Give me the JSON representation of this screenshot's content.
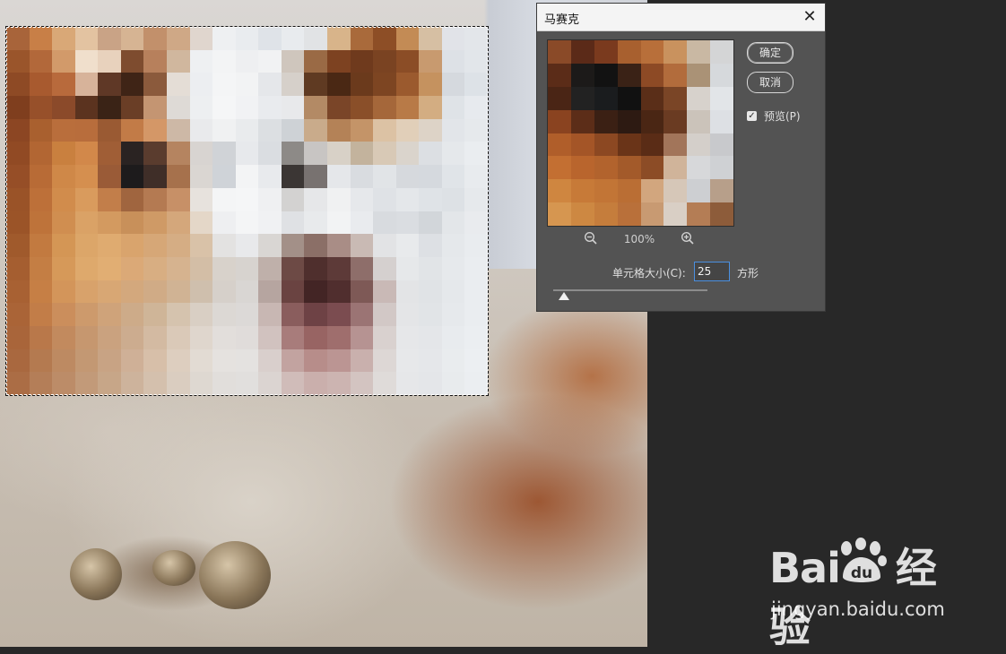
{
  "dialog": {
    "title": "马赛克",
    "close_symbol": "✕",
    "ok_label": "确定",
    "cancel_label": "取消",
    "preview_label": "预览(P)",
    "preview_checked": true,
    "zoom_out_icon": "zoom-out-icon",
    "zoom_in_icon": "zoom-in-icon",
    "zoom_level": "100%",
    "cell_size_label": "单元格大小(C):",
    "cell_size_value": "25",
    "cell_size_unit": "方形",
    "slider_fraction": 0.07
  },
  "watermark": {
    "logo_text": "Bai du 经验",
    "url": "jingyan.baidu.com"
  },
  "colors": {
    "dialog_bg": "#535353",
    "canvas_bg": "#282828",
    "input_focus": "#4a8fe0"
  },
  "mosaic_rows": [
    [
      "#a8643a",
      "#c87f47",
      "#d9a877",
      "#e3c3a1",
      "#c9a386",
      "#d6b493",
      "#c2906b",
      "#cfa886",
      "#e0d6ce",
      "#eef0f2",
      "#e9ecef",
      "#dfe3e8",
      "#e8ebee",
      "#e1e3e5",
      "#d8b48a",
      "#a96a3b",
      "#8d4e26",
      "#c38b55",
      "#d6bfa3",
      "#e1e3e8",
      "#e3e6ea"
    ],
    [
      "#9a552b",
      "#b2683a",
      "#d29a6a",
      "#f0dfcc",
      "#e8d2bd",
      "#7e4c2f",
      "#b7805c",
      "#d0b79e",
      "#eef0f2",
      "#f3f4f5",
      "#eeeff1",
      "#f1f2f3",
      "#cfc6bd",
      "#9a6a45",
      "#7d4221",
      "#6f3a1d",
      "#7a4322",
      "#8b4d26",
      "#c89a6f",
      "#dde1e6",
      "#e2e6ea"
    ],
    [
      "#8e4a25",
      "#a85a2f",
      "#b86a3c",
      "#d7b39a",
      "#5f3826",
      "#3f2416",
      "#8b5a3c",
      "#e4ddd6",
      "#eceef1",
      "#f4f5f6",
      "#f2f3f4",
      "#e5e7ea",
      "#d6d0ca",
      "#5f3a22",
      "#4a2814",
      "#6b3a1c",
      "#7d4522",
      "#9b5a2e",
      "#c5925f",
      "#d5d9de",
      "#dde2e7"
    ],
    [
      "#7f3e1e",
      "#97502a",
      "#8b4a2a",
      "#5b331f",
      "#3a2316",
      "#6a3e26",
      "#c49572",
      "#dedad6",
      "#edeff1",
      "#f5f6f7",
      "#f1f2f4",
      "#e9ebee",
      "#e8e9eb",
      "#b38a65",
      "#7a4528",
      "#8a4f29",
      "#a5673a",
      "#b87a47",
      "#d3ad82",
      "#dfe3e7",
      "#e7eaee"
    ],
    [
      "#8c4623",
      "#a9602f",
      "#b96e3c",
      "#b86d3c",
      "#9a5a33",
      "#c27b47",
      "#d49767",
      "#cdb8a6",
      "#e9eaec",
      "#f0f1f2",
      "#e9ebed",
      "#dcdfe2",
      "#ced2d6",
      "#c9ab8b",
      "#b48257",
      "#c49468",
      "#dcc2a4",
      "#e1cfb9",
      "#ddd3c7",
      "#e2e5e9",
      "#e6e9ec"
    ],
    [
      "#914a24",
      "#b26633",
      "#c9803f",
      "#d2884a",
      "#a05e36",
      "#2a2322",
      "#5a3c2e",
      "#b58460",
      "#d8d4d1",
      "#d0d3d7",
      "#e7e9ec",
      "#dadde1",
      "#8d8a87",
      "#c8c5c3",
      "#d8d1c7",
      "#c3b39d",
      "#d8c9b6",
      "#dad4cc",
      "#dcdfe3",
      "#e5e8eb",
      "#eaedf0"
    ],
    [
      "#964e27",
      "#b86b36",
      "#cf8848",
      "#d58f4f",
      "#9a5b37",
      "#1d1b1c",
      "#3f2e28",
      "#a6714c",
      "#dad6d2",
      "#cfd3d8",
      "#f3f4f5",
      "#e8eaed",
      "#3b3634",
      "#787270",
      "#e5e7ea",
      "#d9dce0",
      "#e1e4e7",
      "#d6d9dd",
      "#d5d9de",
      "#e0e4e8",
      "#e8ebee"
    ],
    [
      "#9a5328",
      "#bd7039",
      "#d18c4c",
      "#d99b5d",
      "#c27e4a",
      "#a0653f",
      "#b47a52",
      "#c79067",
      "#e7e2dd",
      "#f4f5f6",
      "#f5f6f7",
      "#eff0f2",
      "#d3d2d1",
      "#e6e7e9",
      "#f0f1f2",
      "#e6e8eb",
      "#dfe2e6",
      "#e4e7ea",
      "#dfe3e7",
      "#dde1e5",
      "#e6e9ec"
    ],
    [
      "#9b5428",
      "#be733a",
      "#d08e50",
      "#daa266",
      "#d39a60",
      "#c8905a",
      "#cf9a66",
      "#d4a77b",
      "#e4d7c8",
      "#eeeff1",
      "#f4f5f6",
      "#f0f1f3",
      "#dfe1e4",
      "#e8eaec",
      "#f2f3f4",
      "#e9ebee",
      "#d8dbdf",
      "#dadde1",
      "#d2d6da",
      "#e3e6e9",
      "#e9ebee"
    ],
    [
      "#a05a2c",
      "#c27a40",
      "#d49655",
      "#dca669",
      "#dfab70",
      "#d9a46d",
      "#d6a777",
      "#d5ad84",
      "#d9c2a8",
      "#e3e2e1",
      "#e8e9eb",
      "#d9d6d3",
      "#a39088",
      "#8b6f67",
      "#a98d86",
      "#c9bab4",
      "#e2e3e5",
      "#e8eaec",
      "#dde0e4",
      "#e5e8eb",
      "#e9ecef"
    ],
    [
      "#a55e30",
      "#c47e44",
      "#d69959",
      "#dea96c",
      "#e1ae73",
      "#dba977",
      "#d8ae82",
      "#d6b38f",
      "#d3bea6",
      "#d8d2cb",
      "#d7d3cf",
      "#bfb0aa",
      "#6d4a45",
      "#4f2f2d",
      "#5d3a38",
      "#8e6e6a",
      "#d5d0cf",
      "#e6e8ea",
      "#e1e4e7",
      "#e6e9ec",
      "#eaedf0"
    ],
    [
      "#a86133",
      "#c67f45",
      "#d3955a",
      "#d8a26b",
      "#d8a774",
      "#d3a87d",
      "#d0ab86",
      "#d0b394",
      "#cfbfad",
      "#d6d0ca",
      "#d9d6d3",
      "#b6a5a0",
      "#6a4341",
      "#432525",
      "#502e2e",
      "#7e5956",
      "#c9b9b6",
      "#e3e4e6",
      "#e0e3e6",
      "#e5e8eb",
      "#eaedf0"
    ],
    [
      "#aa6437",
      "#c27d48",
      "#cb8e5c",
      "#cd9a6c",
      "#cfa37a",
      "#cdab89",
      "#cfb598",
      "#d5c3ae",
      "#d9cfc4",
      "#dcd8d4",
      "#dcd9d7",
      "#c8b7b3",
      "#8a5d5d",
      "#6e4245",
      "#7b4c50",
      "#9b7474",
      "#d2c8c6",
      "#e4e5e7",
      "#e1e4e7",
      "#e6e9ec",
      "#eaedf0"
    ],
    [
      "#a9653a",
      "#b9784a",
      "#c28a5e",
      "#c6976f",
      "#caa27f",
      "#ccac8f",
      "#d3baa2",
      "#dac9b8",
      "#dfd6cd",
      "#e2dedb",
      "#e0dcda",
      "#d1c2bf",
      "#a87c7b",
      "#986463",
      "#9f6e6d",
      "#b69392",
      "#d9d1cf",
      "#e6e7e9",
      "#e4e6e9",
      "#e8ebee",
      "#ebeef1"
    ],
    [
      "#a9683f",
      "#b47a50",
      "#bd8a62",
      "#c39873",
      "#c8a384",
      "#cfb097",
      "#d7bfa9",
      "#ddcebf",
      "#e2dbd3",
      "#e5e2df",
      "#e4e2e0",
      "#d9cfcc",
      "#c2a3a0",
      "#b78d8a",
      "#bb9593",
      "#c9b0ad",
      "#ddd7d5",
      "#e7e8ea",
      "#e5e7ea",
      "#e9ecee",
      "#eceff2"
    ],
    [
      "#ab6d45",
      "#b47e58",
      "#bc8c68",
      "#c29a79",
      "#c7a688",
      "#cdb39c",
      "#d4c0ad",
      "#dacdc0",
      "#ded8d1",
      "#e1dedb",
      "#e1dfdd",
      "#dbd4d1",
      "#d0bcb9",
      "#caafac",
      "#ccb4b1",
      "#d3c4c1",
      "#dfdbd9",
      "#e6e7e9",
      "#e4e6e9",
      "#e8ebed",
      "#ebeef1"
    ]
  ],
  "preview_rows": [
    [
      "#8a4a28",
      "#5b2a18",
      "#7a3a1e",
      "#a8602f",
      "#b86f3a",
      "#c9925e",
      "#c9b8a3",
      "#d4d5d6"
    ],
    [
      "#5b2c18",
      "#1c1a19",
      "#121212",
      "#3a2216",
      "#8d4a25",
      "#b26c3c",
      "#aa9276",
      "#d6d9dc"
    ],
    [
      "#4a2515",
      "#222222",
      "#1a1c1e",
      "#111111",
      "#5a2e18",
      "#7a4526",
      "#d7d2cc",
      "#e2e5e8"
    ],
    [
      "#8a4320",
      "#5c2d18",
      "#3b2014",
      "#2d1a12",
      "#4a2614",
      "#6a3b22",
      "#cbc3ba",
      "#dde0e4"
    ],
    [
      "#b05e2a",
      "#a45527",
      "#8c4822",
      "#6a3418",
      "#5a2c16",
      "#a2755a",
      "#d4cfca",
      "#c8c9cc"
    ],
    [
      "#c36f32",
      "#b9652d",
      "#b2632d",
      "#a35a2a",
      "#8c4c26",
      "#d0b49a",
      "#d7d8da",
      "#cfd1d4"
    ],
    [
      "#cf8640",
      "#c77a38",
      "#c27536",
      "#ba6e34",
      "#d2a67e",
      "#d6c7b8",
      "#cdcfd2",
      "#b79f8a"
    ],
    [
      "#d69650",
      "#cd8842",
      "#c57d3c",
      "#b9703a",
      "#c89a72",
      "#d9cfc5",
      "#b47d55",
      "#8d5c3a"
    ]
  ]
}
